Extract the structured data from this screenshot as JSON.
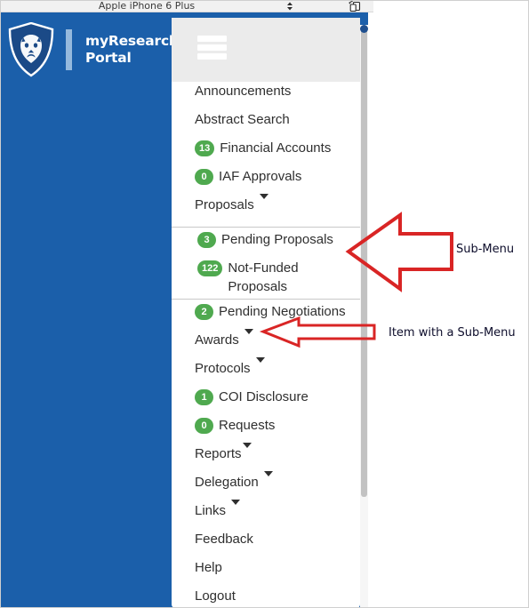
{
  "emulator": {
    "device_name": "Apple iPhone 6 Plus",
    "spinner_icon": "up-down-spinner-icon",
    "rotate_icon": "rotate-device-icon"
  },
  "brand": {
    "logo_icon": "penn-state-nittany-lion-shield-icon",
    "line1": "myResearch",
    "line2": "Portal"
  },
  "header": {
    "menu_toggle_icon": "hamburger-menu-icon"
  },
  "menu": {
    "items": [
      {
        "id": "announcements",
        "label": "Announcements",
        "badge": null,
        "caret": false,
        "indent": false,
        "divider_before": false
      },
      {
        "id": "abstract-search",
        "label": "Abstract Search",
        "badge": null,
        "caret": false,
        "indent": false,
        "divider_before": false
      },
      {
        "id": "financial-accounts",
        "label": "Financial Accounts",
        "badge": "13",
        "caret": false,
        "indent": false,
        "divider_before": false
      },
      {
        "id": "iaf-approvals",
        "label": "IAF Approvals",
        "badge": "0",
        "caret": false,
        "indent": false,
        "divider_before": false
      },
      {
        "id": "proposals",
        "label": "Proposals",
        "badge": null,
        "caret": true,
        "indent": false,
        "divider_before": false
      },
      {
        "id": "pending-proposals",
        "label": "Pending Proposals",
        "badge": "3",
        "caret": false,
        "indent": true,
        "divider_before": true
      },
      {
        "id": "not-funded-proposals",
        "label": "Not-Funded Proposals",
        "badge": "122",
        "caret": false,
        "indent": true,
        "divider_before": false
      },
      {
        "id": "pending-negotiations",
        "label": "Pending Negotiations",
        "badge": "2",
        "caret": false,
        "indent": false,
        "divider_before": true
      },
      {
        "id": "awards",
        "label": "Awards",
        "badge": null,
        "caret": true,
        "indent": false,
        "divider_before": false
      },
      {
        "id": "protocols",
        "label": "Protocols",
        "badge": null,
        "caret": true,
        "indent": false,
        "divider_before": false
      },
      {
        "id": "coi-disclosure",
        "label": "COI Disclosure",
        "badge": "1",
        "caret": false,
        "indent": false,
        "divider_before": false
      },
      {
        "id": "requests",
        "label": "Requests",
        "badge": "0",
        "caret": false,
        "indent": false,
        "divider_before": false
      },
      {
        "id": "reports",
        "label": "Reports",
        "badge": null,
        "caret": true,
        "caret_tight": true,
        "indent": false,
        "divider_before": false
      },
      {
        "id": "delegation",
        "label": "Delegation",
        "badge": null,
        "caret": true,
        "indent": false,
        "divider_before": false
      },
      {
        "id": "links",
        "label": "Links",
        "badge": null,
        "caret": true,
        "indent": false,
        "divider_before": false
      },
      {
        "id": "feedback",
        "label": "Feedback",
        "badge": null,
        "caret": false,
        "indent": false,
        "divider_before": false
      },
      {
        "id": "help",
        "label": "Help",
        "badge": null,
        "caret": false,
        "indent": false,
        "divider_before": false
      },
      {
        "id": "logout",
        "label": "Logout",
        "badge": null,
        "caret": false,
        "indent": false,
        "divider_before": false
      }
    ]
  },
  "annotations": {
    "submenu_label": "Sub-Menu",
    "item_with_submenu_label": "Item with a Sub-Menu",
    "arrow_color": "#d92525"
  },
  "colors": {
    "brand_blue": "#1b5faa",
    "header_grey": "#ebebeb",
    "badge_green": "#4fa94f",
    "panel_white": "#ffffff",
    "divider_grey": "#c9c9c9",
    "annotation_red": "#d92525"
  }
}
